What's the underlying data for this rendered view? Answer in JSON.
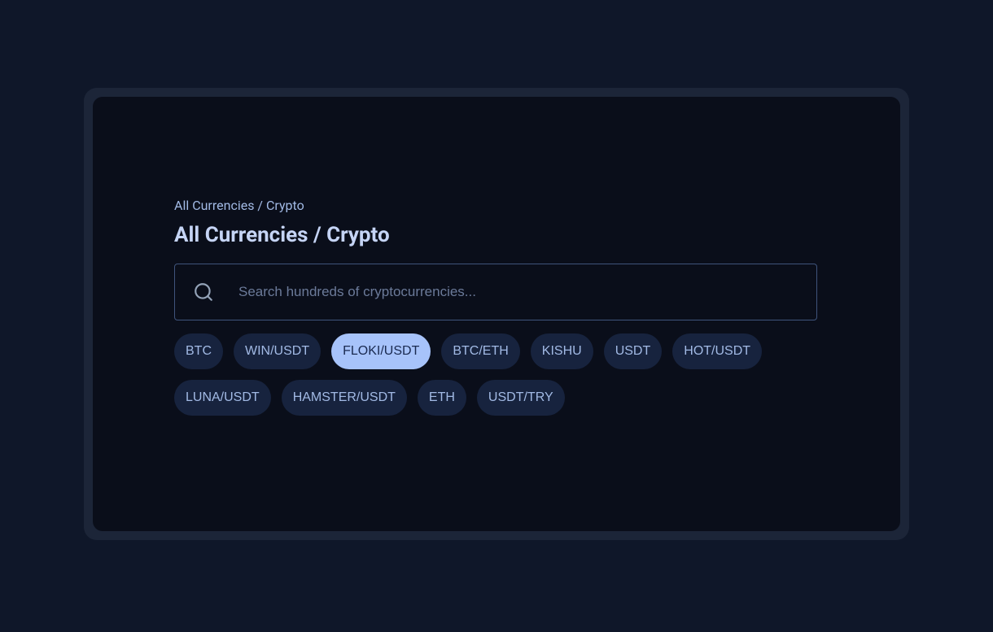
{
  "breadcrumb": "All Currencies / Crypto",
  "title": "All Currencies / Crypto",
  "search": {
    "placeholder": "Search hundreds of cryptocurrencies..."
  },
  "chips": [
    {
      "label": "BTC",
      "active": false
    },
    {
      "label": "WIN/USDT",
      "active": false
    },
    {
      "label": "FLOKI/USDT",
      "active": true
    },
    {
      "label": "BTC/ETH",
      "active": false
    },
    {
      "label": "KISHU",
      "active": false
    },
    {
      "label": "USDT",
      "active": false
    },
    {
      "label": "HOT/USDT",
      "active": false
    },
    {
      "label": "LUNA/USDT",
      "active": false
    },
    {
      "label": "HAMSTER/USDT",
      "active": false
    },
    {
      "label": "ETH",
      "active": false
    },
    {
      "label": "USDT/TRY",
      "active": false
    }
  ]
}
